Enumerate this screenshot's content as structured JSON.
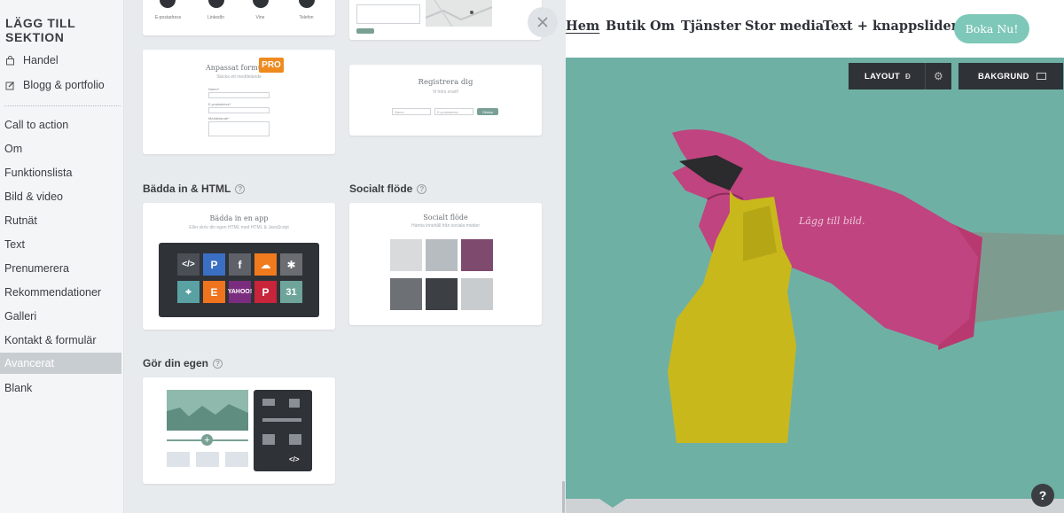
{
  "sidebar": {
    "title": "LÄGG TILL SEKTION",
    "pro_items": [
      {
        "label": "Handel",
        "icon": "bag-icon"
      },
      {
        "label": "Blogg & portfolio",
        "icon": "edit-icon"
      }
    ],
    "items": [
      {
        "label": "Call to action"
      },
      {
        "label": "Om"
      },
      {
        "label": "Funktionslista"
      },
      {
        "label": "Bild & video"
      },
      {
        "label": "Rutnät"
      },
      {
        "label": "Text"
      },
      {
        "label": "Prenumerera"
      },
      {
        "label": "Rekommendationer"
      },
      {
        "label": "Galleri"
      },
      {
        "label": "Kontakt & formulär"
      },
      {
        "label": "Avancerat",
        "active": true
      },
      {
        "label": "Blank"
      }
    ]
  },
  "panel": {
    "top_card_labels": [
      "E-postadress",
      "LinkedIn",
      "Vine",
      "Telefon"
    ],
    "pro_badge": "PRO",
    "form_card": {
      "title": "Anpassat formulär",
      "subtitle": "Skicka ett meddelande",
      "field1": "Namn*",
      "field2": "E-postadress*",
      "field3": "Meddelande*"
    },
    "register_card": {
      "title": "Registrera dig",
      "subtitle": "Vi hörs snart!",
      "input1": "Namn",
      "input2": "E-postadress",
      "button": "Skicka"
    },
    "section_embed": "Bädda in & HTML",
    "section_social": "Socialt flöde",
    "section_custom": "Gör din egen",
    "embed_card": {
      "title": "Bädda in en app",
      "subtitle": "Eller skriv din egen HTML med HTML & JavaScript"
    },
    "social_card": {
      "title": "Socialt flöde",
      "subtitle": "Hämta innehåll från sociala medier"
    }
  },
  "preview": {
    "nav": [
      "Hem",
      "Butik",
      "Om",
      "Tjänster",
      "Stor media",
      "Text + knappslider"
    ],
    "book_button": "Boka Nu!",
    "layout_button": "LAYOUT",
    "background_button": "BAKGRUND",
    "add_image": "Lägg till bild.",
    "help": "?",
    "colors": {
      "accent": "#7ec8b9",
      "teal_bg": "#6fb0a5",
      "glove": "#c0447f",
      "bottle": "#c9b81c",
      "pro_badge": "#ef8a1f"
    }
  }
}
